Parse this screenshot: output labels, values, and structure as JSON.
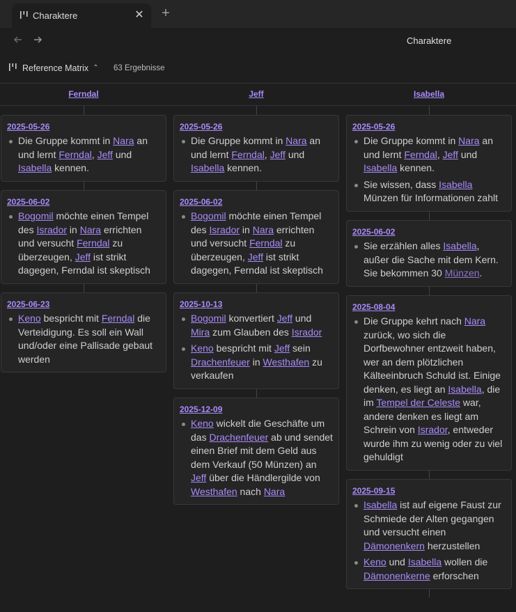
{
  "tab": {
    "title": "Charaktere",
    "icon": "matrix-icon",
    "close_icon": "close-icon",
    "new_icon": "plus-icon"
  },
  "nav": {
    "back_icon": "arrow-left-icon",
    "forward_icon": "arrow-right-icon",
    "view_title": "Charaktere"
  },
  "toolbar": {
    "view_label": "Reference Matrix",
    "results": "63 Ergebnisse"
  },
  "colors": {
    "accent": "#a88bfa",
    "background": "#1e1e1e",
    "card": "#252525"
  },
  "columns": [
    {
      "title": "Ferndal",
      "cards": [
        {
          "date": "2025-05-26",
          "items": [
            [
              [
                "t",
                "Die Gruppe kommt in "
              ],
              [
                "l",
                "Nara"
              ],
              [
                "t",
                " an und lernt "
              ],
              [
                "l",
                "Ferndal"
              ],
              [
                "t",
                ", "
              ],
              [
                "l",
                "Jeff"
              ],
              [
                "t",
                " und "
              ],
              [
                "l",
                "Isabella"
              ],
              [
                "t",
                " kennen."
              ]
            ]
          ]
        },
        {
          "date": "2025-06-02",
          "items": [
            [
              [
                "l",
                "Bogomil"
              ],
              [
                "t",
                " möchte einen Tempel des "
              ],
              [
                "l",
                "Isrador"
              ],
              [
                "t",
                " in "
              ],
              [
                "l",
                "Nara"
              ],
              [
                "t",
                " errichten und versucht "
              ],
              [
                "l",
                "Ferndal"
              ],
              [
                "t",
                " zu überzeugen, "
              ],
              [
                "l",
                "Jeff"
              ],
              [
                "t",
                " ist strikt dagegen, Ferndal ist skeptisch"
              ]
            ]
          ]
        },
        {
          "date": "2025-06-23",
          "items": [
            [
              [
                "l",
                "Keno"
              ],
              [
                "t",
                " bespricht mit "
              ],
              [
                "l",
                "Ferndal"
              ],
              [
                "t",
                " die Verteidigung. Es soll ein Wall und/oder eine Pallisade gebaut werden"
              ]
            ]
          ]
        }
      ]
    },
    {
      "title": "Jeff",
      "cards": [
        {
          "date": "2025-05-26",
          "items": [
            [
              [
                "t",
                "Die Gruppe kommt in "
              ],
              [
                "l",
                "Nara"
              ],
              [
                "t",
                " an und lernt "
              ],
              [
                "l",
                "Ferndal"
              ],
              [
                "t",
                ", "
              ],
              [
                "l",
                "Jeff"
              ],
              [
                "t",
                " und "
              ],
              [
                "l",
                "Isabella"
              ],
              [
                "t",
                " kennen."
              ]
            ]
          ]
        },
        {
          "date": "2025-06-02",
          "items": [
            [
              [
                "l",
                "Bogomil"
              ],
              [
                "t",
                " möchte einen Tempel des "
              ],
              [
                "l",
                "Isrador"
              ],
              [
                "t",
                " in "
              ],
              [
                "l",
                "Nara"
              ],
              [
                "t",
                " errichten und versucht "
              ],
              [
                "l",
                "Ferndal"
              ],
              [
                "t",
                " zu überzeugen, "
              ],
              [
                "l",
                "Jeff"
              ],
              [
                "t",
                " ist strikt dagegen, Ferndal ist skeptisch"
              ]
            ]
          ]
        },
        {
          "date": "2025-10-13",
          "items": [
            [
              [
                "l",
                "Bogomil"
              ],
              [
                "t",
                " konvertiert "
              ],
              [
                "l",
                "Jeff"
              ],
              [
                "t",
                " und "
              ],
              [
                "l",
                "Mira"
              ],
              [
                "t",
                " zum Glauben des "
              ],
              [
                "l",
                "Isrador"
              ]
            ],
            [
              [
                "l",
                "Keno"
              ],
              [
                "t",
                " bespricht mit "
              ],
              [
                "l",
                "Jeff"
              ],
              [
                "t",
                " sein "
              ],
              [
                "l",
                "Drachenfeuer"
              ],
              [
                "t",
                " in "
              ],
              [
                "l",
                "Westhafen"
              ],
              [
                "t",
                " zu verkaufen"
              ]
            ]
          ]
        },
        {
          "date": "2025-12-09",
          "items": [
            [
              [
                "l",
                "Keno"
              ],
              [
                "t",
                " wickelt die Geschäfte um das "
              ],
              [
                "l",
                "Drachenfeuer"
              ],
              [
                "t",
                " ab und sendet einen Brief mit dem Geld aus dem Verkauf (50 Münzen) an "
              ],
              [
                "l",
                "Jeff"
              ],
              [
                "t",
                " über die Händlergilde von "
              ],
              [
                "l",
                "Westhafen"
              ],
              [
                "t",
                " nach "
              ],
              [
                "l",
                "Nara"
              ]
            ]
          ]
        }
      ]
    },
    {
      "title": "Isabella",
      "cards": [
        {
          "date": "2025-05-26",
          "items": [
            [
              [
                "t",
                "Die Gruppe kommt in "
              ],
              [
                "l",
                "Nara"
              ],
              [
                "t",
                " an und lernt "
              ],
              [
                "l",
                "Ferndal"
              ],
              [
                "t",
                ", "
              ],
              [
                "l",
                "Jeff"
              ],
              [
                "t",
                " und "
              ],
              [
                "l",
                "Isabella"
              ],
              [
                "t",
                " kennen."
              ]
            ],
            [
              [
                "t",
                "Sie wissen, dass "
              ],
              [
                "l",
                "Isabella"
              ],
              [
                "t",
                " Münzen für Informationen zahlt"
              ]
            ]
          ]
        },
        {
          "date": "2025-06-02",
          "items": [
            [
              [
                "t",
                "Sie erzählen alles "
              ],
              [
                "l",
                "Isabella"
              ],
              [
                "t",
                ", außer die Sache mit dem Kern. Sie bekommen 30 "
              ],
              [
                "m",
                "Münzen"
              ],
              [
                "t",
                "."
              ]
            ]
          ]
        },
        {
          "date": "2025-08-04",
          "items": [
            [
              [
                "t",
                "Die Gruppe kehrt nach "
              ],
              [
                "l",
                "Nara"
              ],
              [
                "t",
                " zurück, wo sich die Dorfbewohner entzweit haben, wer an dem plötzlichen Kälteeinbruch Schuld ist. Einige denken, es liegt an "
              ],
              [
                "l",
                "Isabella"
              ],
              [
                "t",
                ", die im "
              ],
              [
                "l",
                "Tempel der Celeste"
              ],
              [
                "t",
                " war, andere denken es liegt am Schrein von "
              ],
              [
                "l",
                "Isrador"
              ],
              [
                "t",
                ", entweder wurde ihm zu wenig oder zu viel gehuldigt"
              ]
            ]
          ]
        },
        {
          "date": "2025-09-15",
          "items": [
            [
              [
                "l",
                "Isabella"
              ],
              [
                "t",
                " ist auf eigene Faust zur Schmiede der Alten gegangen und versucht einen "
              ],
              [
                "l",
                "Dämonenkern"
              ],
              [
                "t",
                " herzustellen"
              ]
            ],
            [
              [
                "l",
                "Keno"
              ],
              [
                "t",
                " und "
              ],
              [
                "l",
                "Isabella"
              ],
              [
                "t",
                " wollen die "
              ],
              [
                "l",
                "Dämonenkerne"
              ],
              [
                "t",
                " erforschen"
              ]
            ]
          ]
        }
      ]
    }
  ]
}
